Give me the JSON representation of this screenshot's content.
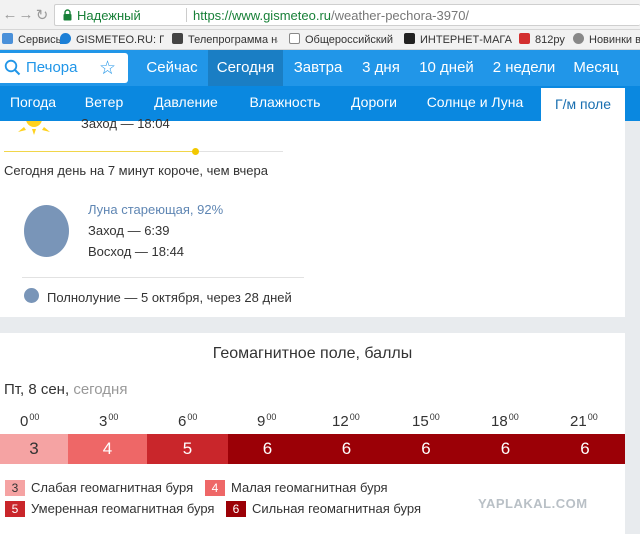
{
  "browser": {
    "secure_label": "Надежный",
    "url_main": "https://www.gismeteo.ru",
    "url_rest": "/weather-pechora-3970/",
    "bookmarks": [
      "Сервисы",
      "GISMETEO.RU: Погод",
      "Телепрограмма на н",
      "Общероссийский ба",
      "ИНТЕРНЕТ-МАГАЗИН",
      "812ру",
      "Новинки в А"
    ]
  },
  "search": {
    "value": "Печора"
  },
  "tabs": [
    "Сейчас",
    "Сегодня",
    "Завтра",
    "3 дня",
    "10 дней",
    "2 недели",
    "Месяц"
  ],
  "active_tab": 1,
  "subnav": [
    "Погода",
    "Ветер",
    "Давление",
    "Влажность",
    "Дороги",
    "Солнце и Луна",
    "Г/м поле"
  ],
  "active_sub": 6,
  "sun": {
    "sunset": "Заход — 18:04",
    "daylight_note": "Сегодня день на 7 минут короче, чем вчера"
  },
  "moon": {
    "phase": "Луна стареющая, 92%",
    "set": "Заход — 6:39",
    "rise": "Восход — 18:44",
    "full_moon": "Полнолуние — 5 октября, через 28 дней"
  },
  "geo": {
    "title": "Геомагнитное поле, баллы",
    "date": "Пт, 8 сен,",
    "today": "сегодня",
    "hours": [
      {
        "h": "0",
        "m": "00"
      },
      {
        "h": "3",
        "m": "00"
      },
      {
        "h": "6",
        "m": "00"
      },
      {
        "h": "9",
        "m": "00"
      },
      {
        "h": "12",
        "m": "00"
      },
      {
        "h": "15",
        "m": "00"
      },
      {
        "h": "18",
        "m": "00"
      },
      {
        "h": "21",
        "m": "00"
      }
    ],
    "values": [
      3,
      4,
      5,
      6,
      6,
      6,
      6,
      6
    ],
    "legend": [
      {
        "value": "3",
        "label": "Слабая геомагнитная буря"
      },
      {
        "value": "4",
        "label": "Малая геомагнитная буря"
      },
      {
        "value": "5",
        "label": "Умеренная геомагнитная буря"
      },
      {
        "value": "6",
        "label": "Сильная геомагнитная буря"
      }
    ],
    "colors": {
      "3": "#f5a3a3",
      "4": "#ee6767",
      "5": "#c9262b",
      "6": "#9b0006"
    }
  },
  "watermark": "YAPLAKAL.COM"
}
